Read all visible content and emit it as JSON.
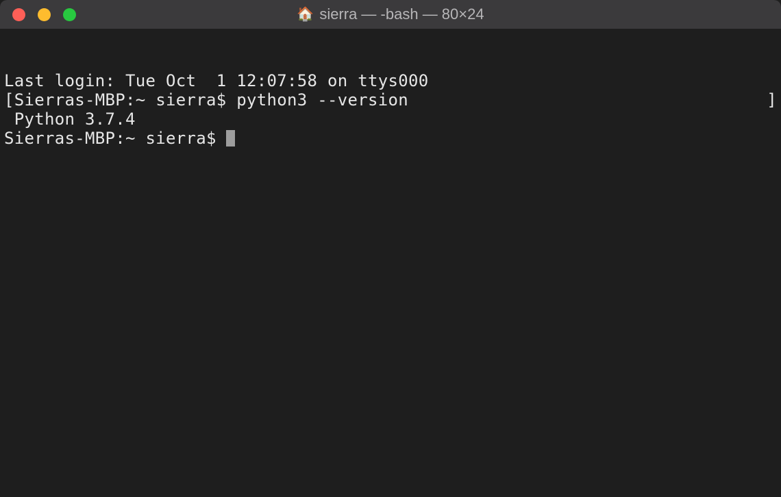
{
  "titlebar": {
    "icon": "🏠",
    "title": "sierra — -bash — 80×24"
  },
  "terminal": {
    "line1": "Last login: Tue Oct  1 12:07:58 on ttys000",
    "line2_left_bracket": "[",
    "line2_prompt": "Sierras-MBP:~ sierra$ ",
    "line2_command": "python3 --version",
    "line2_right_bracket": "]",
    "line3": " Python 3.7.4",
    "line4_prompt": "Sierras-MBP:~ sierra$ "
  }
}
